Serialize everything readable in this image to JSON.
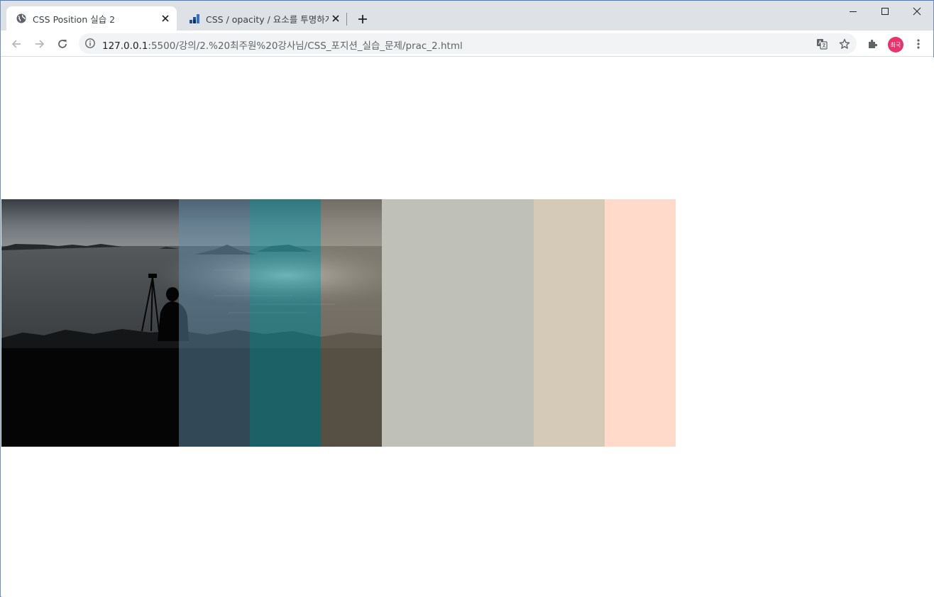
{
  "browser": {
    "tabs": [
      {
        "title": "CSS Position 실습 2",
        "active": true,
        "icon": "globe-icon"
      },
      {
        "title": "CSS / opacity / 요소를 투명하게",
        "active": false,
        "icon": "bar-chart-icon"
      }
    ],
    "address_bar": {
      "host": "127.0.0.1",
      "path": ":5500/강의/2.%20최주원%20강사님/CSS_포지션_실습_문제/prac_2.html"
    },
    "profile_label": "최국"
  },
  "page": {
    "overlays": [
      {
        "color": "#5f8ba8",
        "opacity": 0.5
      },
      {
        "color": "#2a9fa5",
        "opacity": 0.6
      },
      {
        "color": "#a89a83",
        "opacity": 0.5
      }
    ],
    "swatches": [
      {
        "color": "#bfc1b8"
      },
      {
        "color": "#d5cab8"
      },
      {
        "color": "#ffd9c9"
      }
    ]
  },
  "colors": {
    "tabstrip_bg": "#dee1e6",
    "omnibox_bg": "#f1f3f4",
    "profile_bg": "#e8336d"
  }
}
